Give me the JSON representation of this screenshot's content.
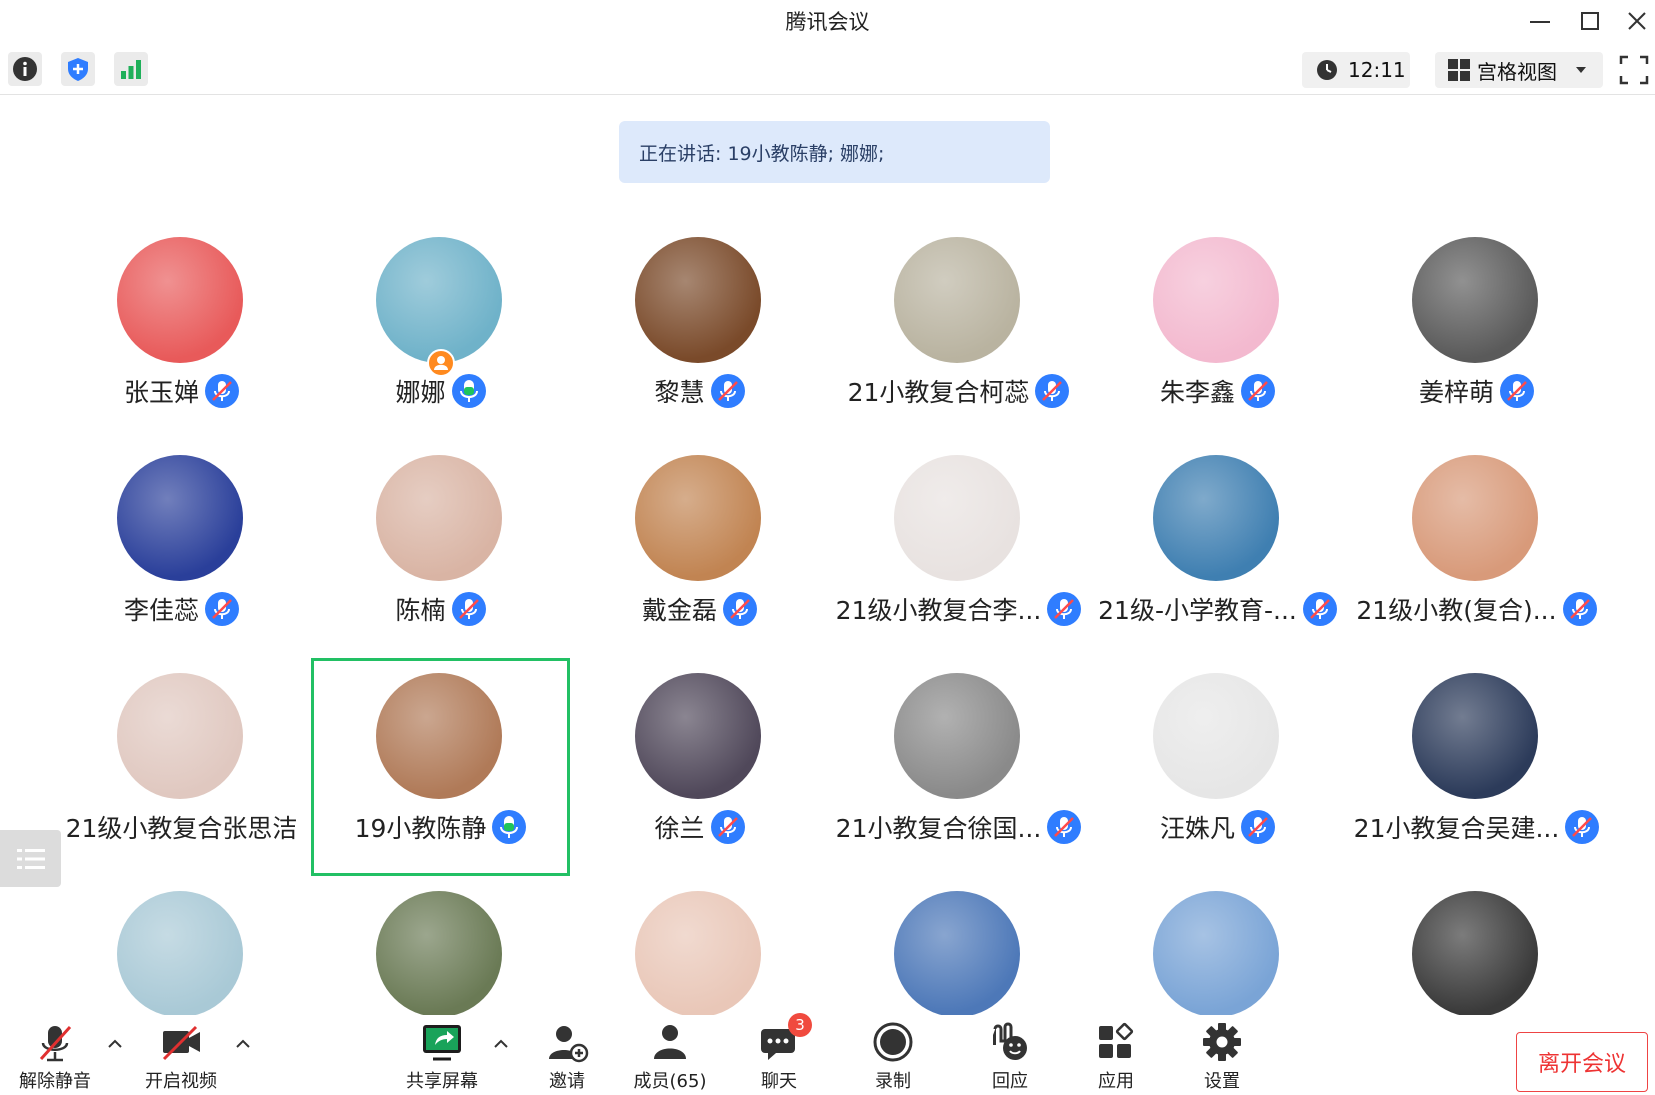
{
  "app": {
    "title": "腾讯会议"
  },
  "toolbar": {
    "time": "12:11",
    "view_label": "宫格视图"
  },
  "speaking": {
    "text": "正在讲话: 19小教陈静; 娜娜;"
  },
  "participants": [
    {
      "name": "张玉婵",
      "mic": "muted",
      "avatar_color": "#e85a5a"
    },
    {
      "name": "娜娜",
      "mic": "speaking",
      "avatar_color": "#6fb2c9",
      "host_badge": true
    },
    {
      "name": "黎慧",
      "mic": "muted",
      "avatar_color": "#7a4a2a"
    },
    {
      "name": "21小教复合柯蕊",
      "mic": "muted",
      "avatar_color": "#b9b3a0"
    },
    {
      "name": "朱李鑫",
      "mic": "muted",
      "avatar_color": "#f3b9cf"
    },
    {
      "name": "姜梓萌",
      "mic": "muted",
      "avatar_color": "#5a5a5a"
    },
    {
      "name": "李佳蕊",
      "mic": "muted",
      "avatar_color": "#2a3f9a"
    },
    {
      "name": "陈楠",
      "mic": "muted",
      "avatar_color": "#d9b4a4"
    },
    {
      "name": "戴金磊",
      "mic": "muted",
      "avatar_color": "#c18452"
    },
    {
      "name": "21级小教复合李...",
      "mic": "muted",
      "avatar_color": "#e8e2e0"
    },
    {
      "name": "21级-小学教育-...",
      "mic": "muted",
      "avatar_color": "#3f7fb1"
    },
    {
      "name": "21级小教(复合)...",
      "mic": "muted",
      "avatar_color": "#d89a7a"
    },
    {
      "name": "21级小教复合张思洁",
      "mic": "none",
      "avatar_color": "#e0c8c0"
    },
    {
      "name": "19小教陈静",
      "mic": "speaking",
      "avatar_color": "#b07a58",
      "active": true
    },
    {
      "name": "徐兰",
      "mic": "muted",
      "avatar_color": "#50485a"
    },
    {
      "name": "21小教复合徐国...",
      "mic": "muted",
      "avatar_color": "#8a8a8a"
    },
    {
      "name": "汪姝凡",
      "mic": "muted",
      "avatar_color": "#e6e6e6"
    },
    {
      "name": "21小教复合吴建...",
      "mic": "muted",
      "avatar_color": "#2c3b5a"
    },
    {
      "name": "",
      "mic": "none",
      "avatar_color": "#a9c9d6"
    },
    {
      "name": "",
      "mic": "none",
      "avatar_color": "#6a7a55"
    },
    {
      "name": "",
      "mic": "none",
      "avatar_color": "#e9c7b8"
    },
    {
      "name": "",
      "mic": "none",
      "avatar_color": "#4d78b8"
    },
    {
      "name": "",
      "mic": "none",
      "avatar_color": "#7aa4d6"
    },
    {
      "name": "",
      "mic": "none",
      "avatar_color": "#3a3a3a"
    }
  ],
  "bottom": {
    "unmute": "解除静音",
    "video": "开启视频",
    "share": "共享屏幕",
    "invite": "邀请",
    "members": "成员(65)",
    "chat": "聊天",
    "chat_badge": "3",
    "record": "录制",
    "react": "回应",
    "apps": "应用",
    "settings": "设置",
    "leave": "离开会议"
  },
  "colors": {
    "accent": "#2f7dff",
    "speaking_green": "#22c064",
    "leave_red": "#e33333"
  }
}
